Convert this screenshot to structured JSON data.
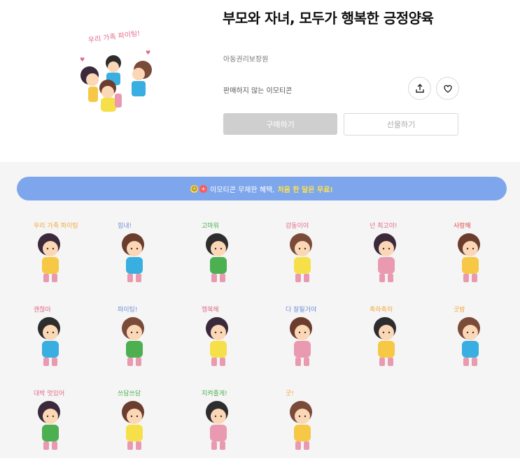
{
  "product": {
    "title": "부모와 자녀, 모두가 행복한 긍정양육",
    "author": "아동권리보장원",
    "notice": "판매하지 않는 이모티콘",
    "buy_label": "구매하기",
    "gift_label": "선물하기",
    "hero_caption": "우리 가족 파이팅!"
  },
  "icons": {
    "share": "share-icon",
    "like": "heart-icon"
  },
  "banner": {
    "text": "이모티콘 무제한 혜택,",
    "highlight": "처음 한 달은 무료!",
    "accent_color": "#7ea6ec",
    "highlight_color": "#ffe24a"
  },
  "stickers": [
    {
      "caption": "우리 가족 파이팅",
      "accent": "#f2a93b"
    },
    {
      "caption": "힘내!",
      "accent": "#6f8fd9"
    },
    {
      "caption": "고마워",
      "accent": "#4caf50"
    },
    {
      "caption": "감동이야",
      "accent": "#e26b8a"
    },
    {
      "caption": "넌 최고야!",
      "accent": "#e26b8a"
    },
    {
      "caption": "사랑해",
      "accent": "#e04b4b"
    },
    {
      "caption": "괜찮아",
      "accent": "#e26b8a"
    },
    {
      "caption": "파이팅!",
      "accent": "#6f8fd9"
    },
    {
      "caption": "행복해",
      "accent": "#e26b8a"
    },
    {
      "caption": "다 잘될거야",
      "accent": "#6f8fd9"
    },
    {
      "caption": "축하축하",
      "accent": "#f2a93b"
    },
    {
      "caption": "굿밤",
      "accent": "#f2a93b"
    },
    {
      "caption": "대박 멋있어",
      "accent": "#e26b8a"
    },
    {
      "caption": "쓰담쓰담",
      "accent": "#4caf50"
    },
    {
      "caption": "지켜줄게!",
      "accent": "#4caf50"
    },
    {
      "caption": "굿!",
      "accent": "#f2a93b"
    }
  ]
}
